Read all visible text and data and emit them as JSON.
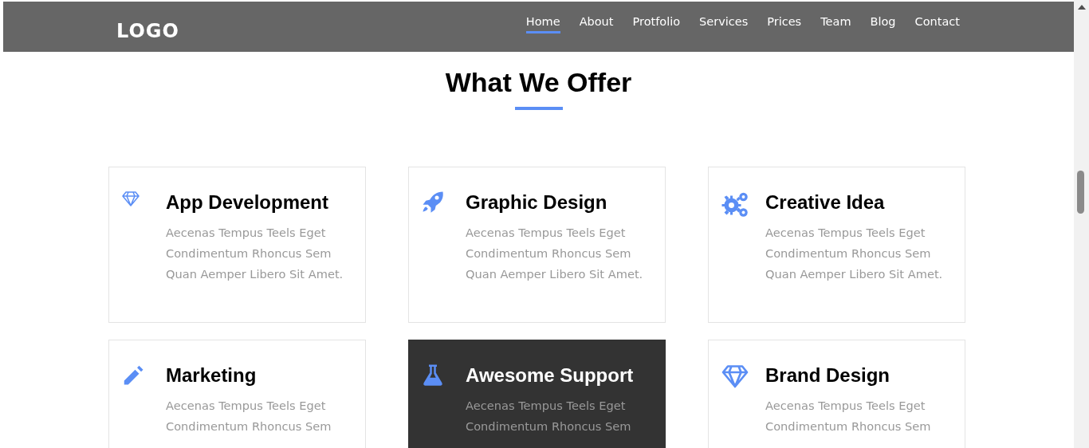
{
  "navbar": {
    "logo": "LOGO",
    "links": [
      {
        "label": "Home",
        "selected": true
      },
      {
        "label": "About",
        "selected": false
      },
      {
        "label": "Protfolio",
        "selected": false
      },
      {
        "label": "Services",
        "selected": false
      },
      {
        "label": "Prices",
        "selected": false
      },
      {
        "label": "Team",
        "selected": false
      },
      {
        "label": "Blog",
        "selected": false
      },
      {
        "label": "Contact",
        "selected": false
      }
    ]
  },
  "section": {
    "title": "What We Offer",
    "cards": [
      {
        "title": "App Development",
        "text": "Aecenas Tempus Teels Eget Condimentum Rhoncus Sem Quan Aemper Libero Sit Amet.",
        "highlighted": false
      },
      {
        "title": "Graphic Design",
        "text": "Aecenas Tempus Teels Eget Condimentum Rhoncus Sem Quan Aemper Libero Sit Amet.",
        "highlighted": false
      },
      {
        "title": "Creative Idea",
        "text": "Aecenas Tempus Teels Eget Condimentum Rhoncus Sem Quan Aemper Libero Sit Amet.",
        "highlighted": false
      },
      {
        "title": "Marketing",
        "text": "Aecenas Tempus Teels Eget Condimentum Rhoncus Sem",
        "highlighted": false
      },
      {
        "title": "Awesome Support",
        "text": "Aecenas Tempus Teels Eget Condimentum Rhoncus Sem",
        "highlighted": true
      },
      {
        "title": "Brand Design",
        "text": "Aecenas Tempus Teels Eget Condimentum Rhoncus Sem",
        "highlighted": false
      }
    ]
  }
}
